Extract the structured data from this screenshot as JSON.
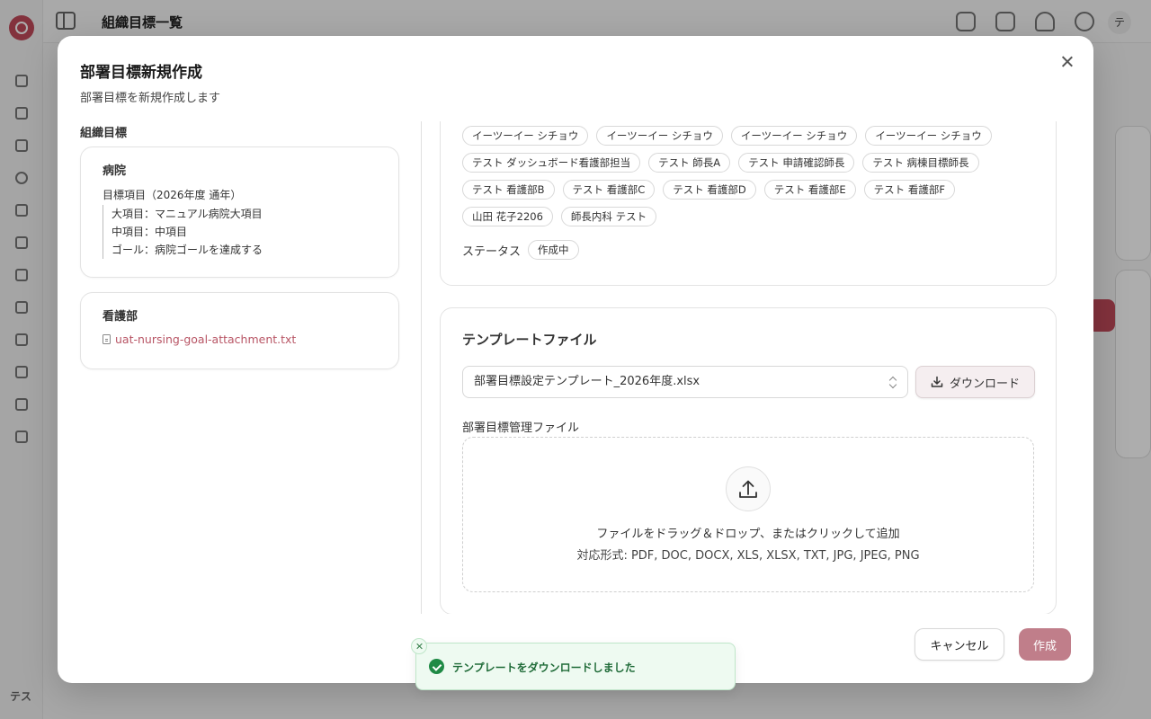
{
  "background": {
    "header_title": "組織目標一覧",
    "user_initials": "テ",
    "sidebar_user": "テス"
  },
  "dialog": {
    "title": "部署目標新規作成",
    "description": "部署目標を新規作成します"
  },
  "left": {
    "heading": "組織目標",
    "hospital": {
      "name": "病院",
      "goal_item": "目標項目（2026年度 通年）",
      "lines": [
        "大項目：マニュアル病院大項目",
        "中項目：中項目",
        "ゴール：病院ゴールを達成する"
      ]
    },
    "nursing": {
      "name": "看護部",
      "attachment": "uat-nursing-goal-attachment.txt"
    }
  },
  "assignees": {
    "chips": [
      "イーツーイー シチョウ",
      "イーツーイー シチョウ",
      "イーツーイー シチョウ",
      "イーツーイー シチョウ",
      "テスト ダッシュボード看護部担当",
      "テスト 師長A",
      "テスト 申請確認師長",
      "テスト 病棟目標師長",
      "テスト 看護部B",
      "テスト 看護部C",
      "テスト 看護部D",
      "テスト 看護部E",
      "テスト 看護部F",
      "山田 花子2206",
      "師長内科 テスト"
    ],
    "status_label": "ステータス",
    "status_value": "作成中"
  },
  "template": {
    "title": "テンプレートファイル",
    "selected_file": "部署目標設定テンプレート_2026年度.xlsx",
    "download_label": "ダウンロード",
    "management_label": "部署目標管理ファイル",
    "dropzone_main": "ファイルをドラッグ＆ドロップ、またはクリックして追加",
    "dropzone_formats": "対応形式: PDF, DOC, DOCX, XLS, XLSX, TXT, JPG, JPEG, PNG"
  },
  "footer": {
    "cancel_label": "キャンセル",
    "create_label": "作成"
  },
  "toast": {
    "message": "テンプレートをダウンロードしました"
  },
  "colors": {
    "accent": "#c14a5a",
    "create_button": "#c07e8a",
    "toast_success": "#1f8a45"
  }
}
